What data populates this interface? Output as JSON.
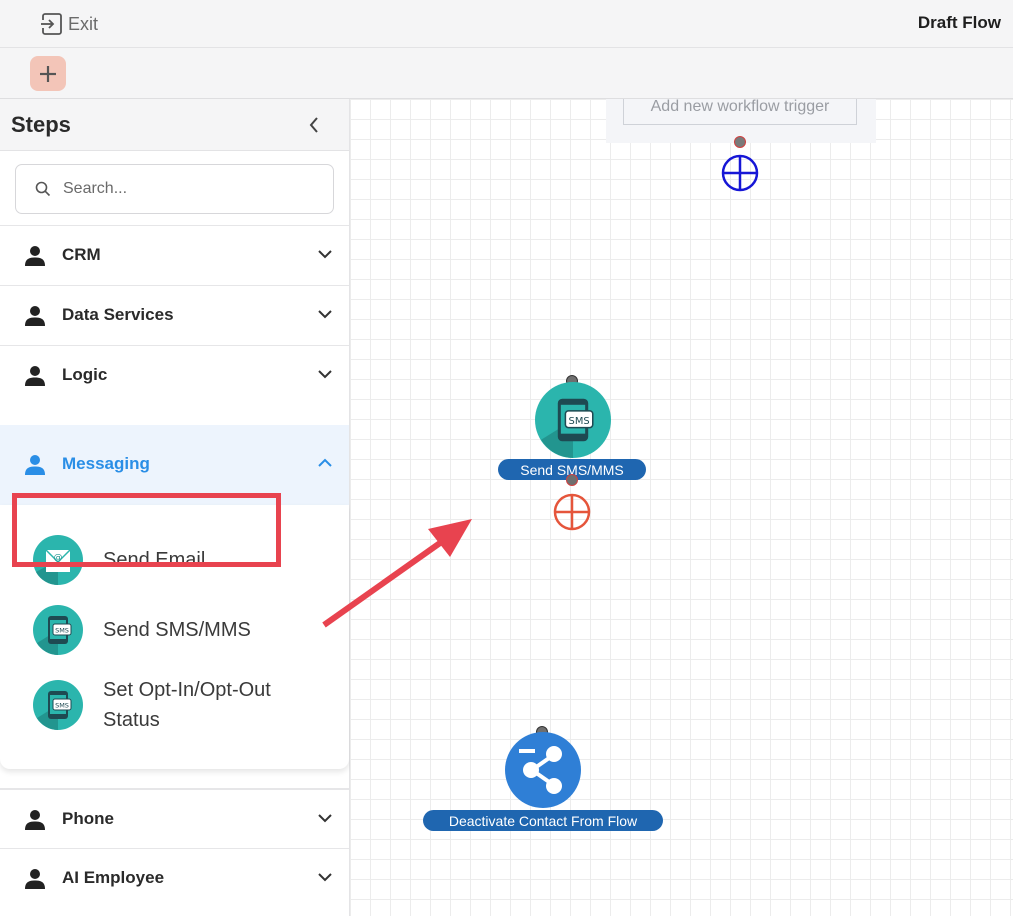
{
  "topbar": {
    "exit_label": "Exit",
    "title": "Draft Flow"
  },
  "sidebar": {
    "title": "Steps",
    "search_placeholder": "Search...",
    "categories": [
      {
        "label": "CRM"
      },
      {
        "label": "Data Services"
      },
      {
        "label": "Logic"
      },
      {
        "label": "Messaging"
      },
      {
        "label": "Phone"
      },
      {
        "label": "AI Employee"
      }
    ],
    "messaging_items": [
      {
        "label": "Send Email",
        "icon": "email-icon"
      },
      {
        "label": "Send SMS/MMS",
        "icon": "sms-icon"
      },
      {
        "label": "Set Opt-In/Opt-Out Status",
        "line1": "Set Opt-In/Opt-Out",
        "line2": "Status",
        "icon": "sms-icon"
      }
    ]
  },
  "canvas": {
    "trigger_label": "Add new workflow trigger",
    "nodes": [
      {
        "label": "Send SMS/MMS",
        "icon": "sms-icon"
      },
      {
        "label": "Deactivate Contact From Flow",
        "icon": "share-icon"
      }
    ]
  },
  "colors": {
    "accent": "#2a8ee6",
    "node_label_bg": "#1f66b0",
    "teal": "#2bb5ad",
    "highlight": "#e8434f",
    "add_button": "#f3c5b8"
  }
}
